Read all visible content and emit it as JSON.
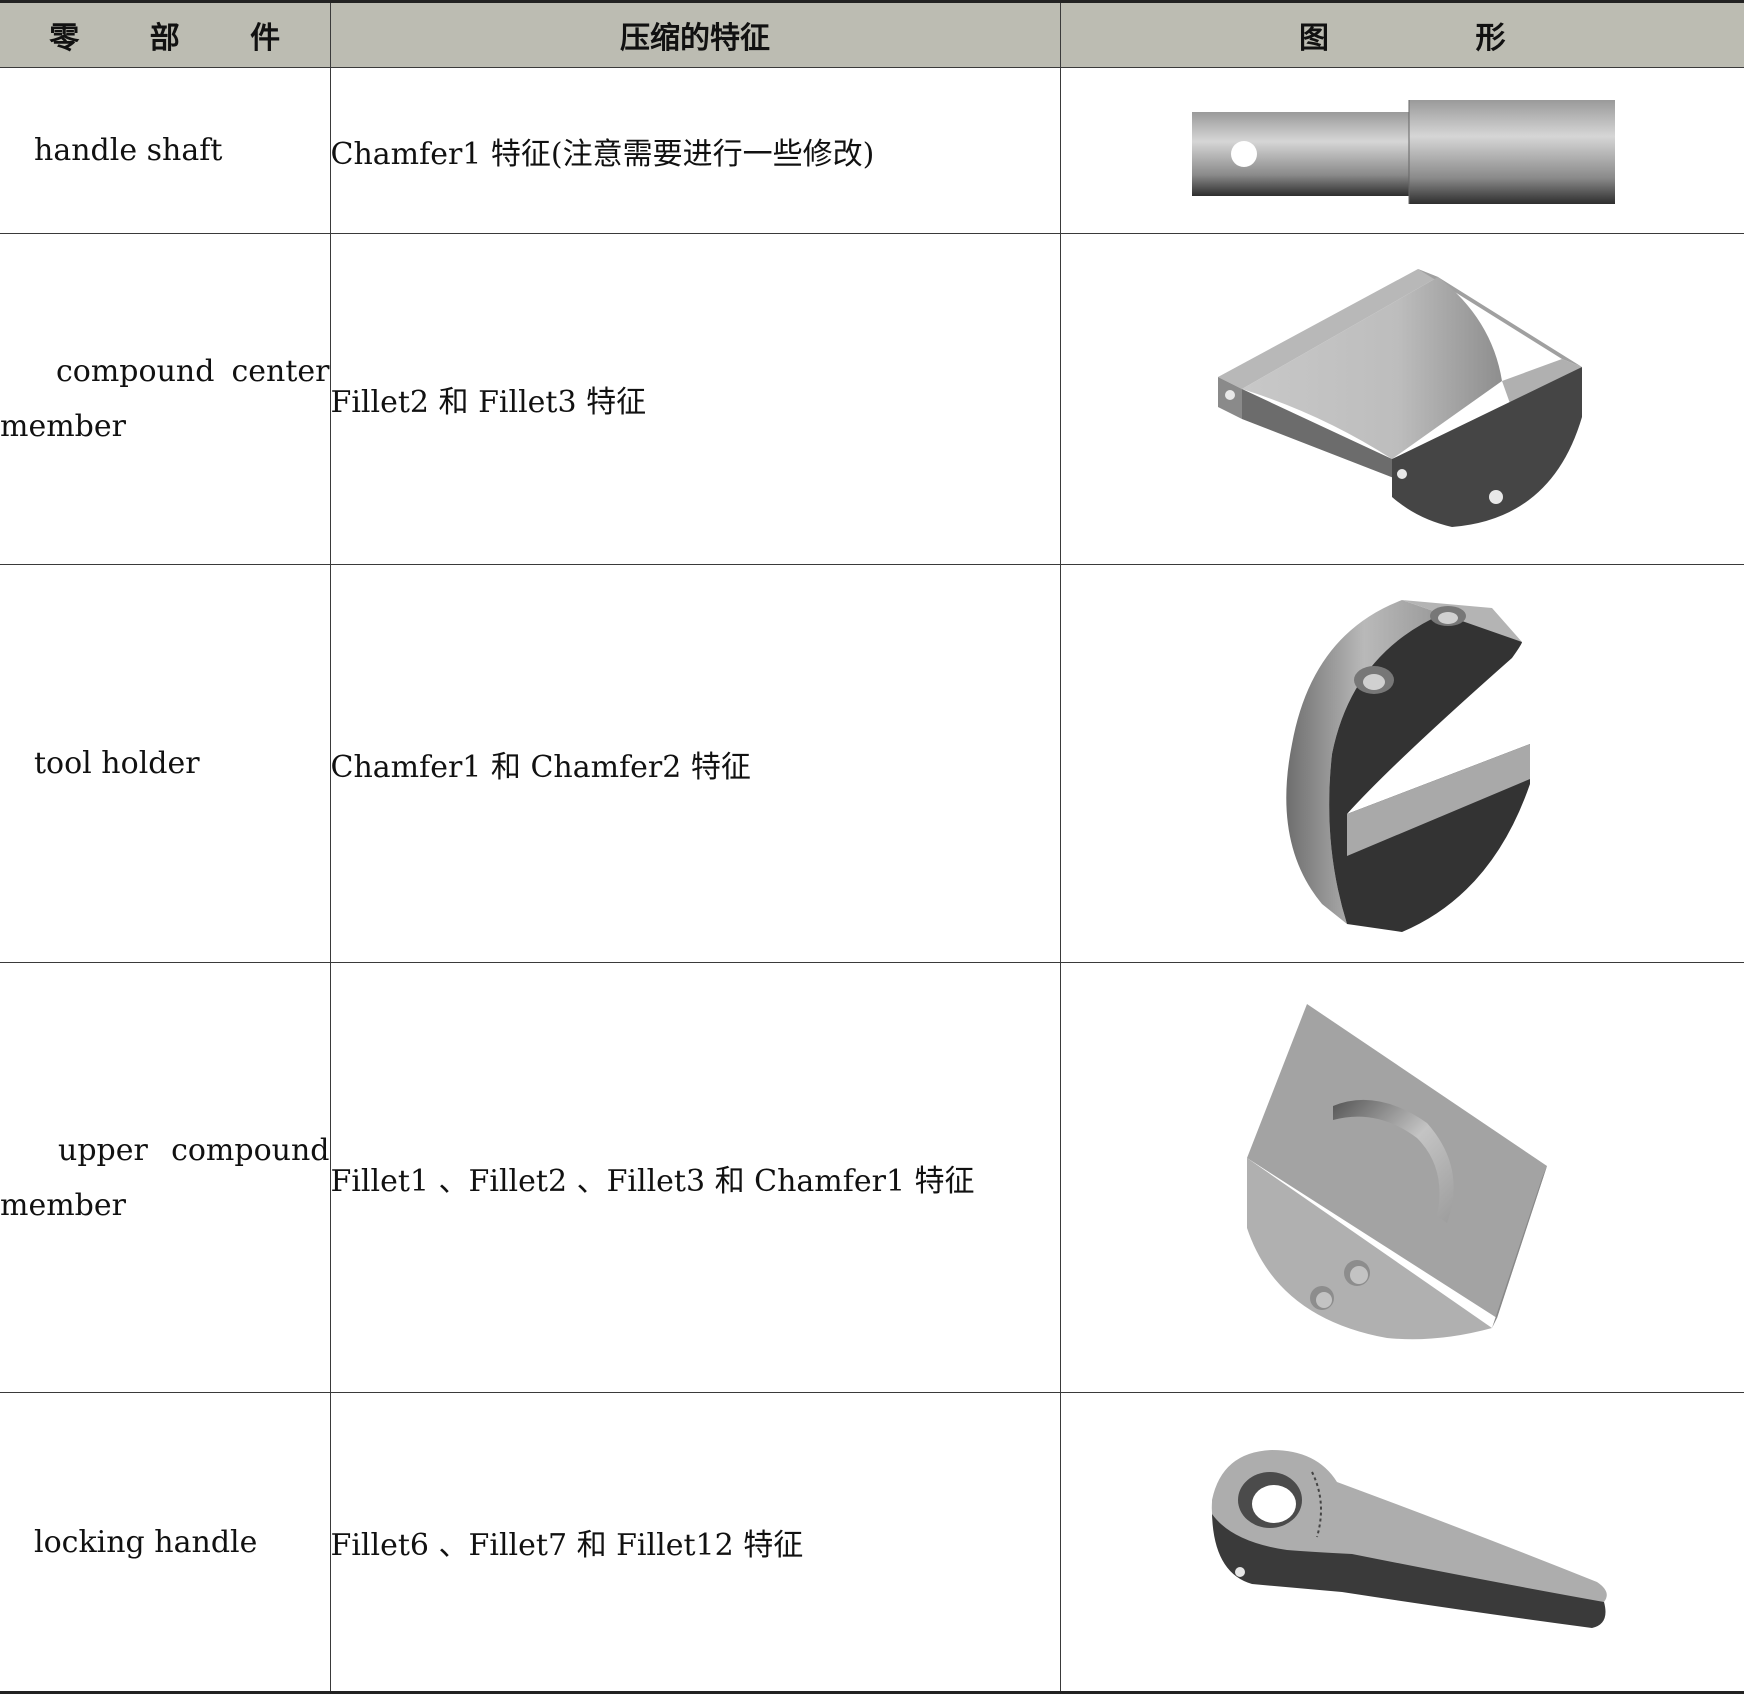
{
  "header": {
    "col_part": "零 部 件",
    "col_features": "压缩的特征",
    "col_shape": "图 形"
  },
  "rows": [
    {
      "part": "handle shaft",
      "features": "Chamfer1 特征(注意需要进行一些修改)",
      "shape": "handle-shaft-render"
    },
    {
      "part": "compound center member",
      "features": "Fillet2 和 Fillet3 特征",
      "shape": "compound-center-member-render"
    },
    {
      "part": "tool holder",
      "features": "Chamfer1 和 Chamfer2 特征",
      "shape": "tool-holder-render"
    },
    {
      "part": "upper compound member",
      "features": "Fillet1 、Fillet2 、Fillet3 和 Chamfer1 特征",
      "shape": "upper-compound-member-render"
    },
    {
      "part": "locking handle",
      "features": "Fillet6 、Fillet7 和 Fillet12 特征",
      "shape": "locking-handle-render"
    }
  ]
}
